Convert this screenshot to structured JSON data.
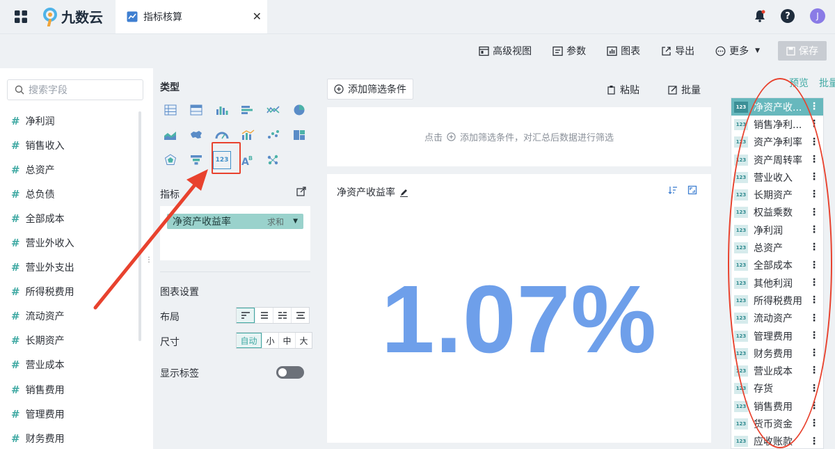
{
  "app": {
    "brand": "九数云",
    "tab_title": "指标核算"
  },
  "user": {
    "avatar_initial": "J"
  },
  "toolbar": {
    "advanced_view": "高级视图",
    "params": "参数",
    "chart": "图表",
    "export": "导出",
    "more": "更多",
    "save": "保存"
  },
  "fields": {
    "search_placeholder": "搜索字段",
    "items": [
      "净利润",
      "销售收入",
      "总资产",
      "总负债",
      "全部成本",
      "营业外收入",
      "营业外支出",
      "所得税费用",
      "流动资产",
      "长期资产",
      "营业成本",
      "销售费用",
      "管理费用",
      "财务费用"
    ]
  },
  "config": {
    "type_title": "类型",
    "metric_title": "指标",
    "metric_field": "净资产收益率",
    "metric_agg": "求和",
    "chart_settings_title": "图表设置",
    "layout_label": "布局",
    "size_label": "尺寸",
    "size_options": [
      "自动",
      "小",
      "中",
      "大"
    ],
    "show_label": "显示标签",
    "show_label_on": false
  },
  "main": {
    "add_filter": "添加筛选条件",
    "paste": "粘贴",
    "batch": "批量",
    "filter_hint_prefix": "点击",
    "filter_hint_suffix": "添加筛选条件，对汇总后数据进行筛选",
    "card_title": "净资产收益率",
    "value": "1.07%"
  },
  "right_panel": {
    "tab_preview": "预览",
    "tab_batch": "批量",
    "badge": "123",
    "items": [
      "净资产收...",
      "销售净利...",
      "资产净利率",
      "资产周转率",
      "营业收入",
      "长期资产",
      "权益乘数",
      "净利润",
      "总资产",
      "全部成本",
      "其他利润",
      "所得税费用",
      "流动资产",
      "管理费用",
      "财务费用",
      "营业成本",
      "存货",
      "销售费用",
      "货币资金",
      "应收账款"
    ]
  },
  "colors": {
    "accent": "#3fa9a3",
    "value": "#6e9fea",
    "annotation": "#e8422e"
  }
}
